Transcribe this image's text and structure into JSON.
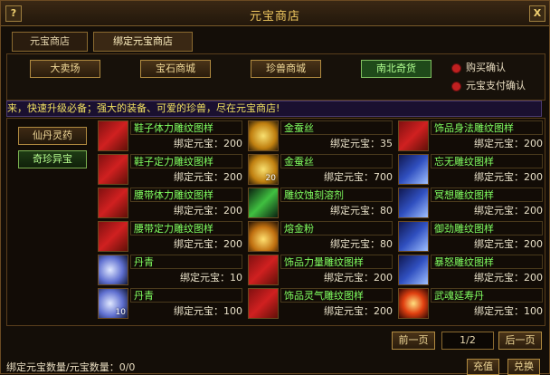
{
  "window": {
    "title": "元宝商店",
    "help_glyph": "?",
    "close_glyph": "X"
  },
  "tabs": [
    {
      "label": "元宝商店",
      "active": false
    },
    {
      "label": "绑定元宝商店",
      "active": true
    }
  ],
  "categories": [
    {
      "label": "大卖场",
      "active": false
    },
    {
      "label": "宝石商城",
      "active": false
    },
    {
      "label": "珍兽商城",
      "active": false
    },
    {
      "label": "南北奇货",
      "active": true
    }
  ],
  "options": [
    {
      "label": "购买确认",
      "checked": true
    },
    {
      "label": "元宝支付确认",
      "checked": true
    }
  ],
  "ticker": "来，快速升级必备；强大的装备、可爱的珍兽，尽在元宝商店!",
  "side_buttons": [
    {
      "label": "仙丹灵药",
      "active": false
    },
    {
      "label": "奇珍异宝",
      "active": true
    }
  ],
  "items": [
    {
      "name": "鞋子体力雕纹图样",
      "price": "绑定元宝：200",
      "icon": "red-scroll-icon",
      "qty": ""
    },
    {
      "name": "金蚕丝",
      "price": "绑定元宝：35",
      "icon": "golden-silk-icon",
      "qty": ""
    },
    {
      "name": "饰品身法雕纹图样",
      "price": "绑定元宝：200",
      "icon": "red-scroll-icon",
      "qty": ""
    },
    {
      "name": "鞋子定力雕纹图样",
      "price": "绑定元宝：200",
      "icon": "red-scroll-icon",
      "qty": ""
    },
    {
      "name": "金蚕丝",
      "price": "绑定元宝：700",
      "icon": "golden-silk-icon",
      "qty": "20"
    },
    {
      "name": "忘无雕纹图样",
      "price": "绑定元宝：200",
      "icon": "blue-scroll-icon",
      "qty": ""
    },
    {
      "name": "腰带体力雕纹图样",
      "price": "绑定元宝：200",
      "icon": "red-scroll-icon",
      "qty": ""
    },
    {
      "name": "雕纹蚀刻溶剂",
      "price": "绑定元宝：80",
      "icon": "green-blade-icon",
      "qty": ""
    },
    {
      "name": "冥想雕纹图样",
      "price": "绑定元宝：200",
      "icon": "blue-scroll-icon",
      "qty": ""
    },
    {
      "name": "腰带定力雕纹图样",
      "price": "绑定元宝：200",
      "icon": "red-scroll-icon",
      "qty": ""
    },
    {
      "name": "熔金粉",
      "price": "绑定元宝：80",
      "icon": "gold-powder-icon",
      "qty": ""
    },
    {
      "name": "御劲雕纹图样",
      "price": "绑定元宝：200",
      "icon": "blue-scroll-icon",
      "qty": ""
    },
    {
      "name": "丹青",
      "price": "绑定元宝：10",
      "icon": "blue-cloud-icon",
      "qty": ""
    },
    {
      "name": "饰品力量雕纹图样",
      "price": "绑定元宝：200",
      "icon": "red-scroll-icon",
      "qty": ""
    },
    {
      "name": "暴怒雕纹图样",
      "price": "绑定元宝：200",
      "icon": "blue-scroll-icon",
      "qty": ""
    },
    {
      "name": "丹青",
      "price": "绑定元宝：100",
      "icon": "blue-cloud-icon",
      "qty": "10"
    },
    {
      "name": "饰品灵气雕纹图样",
      "price": "绑定元宝：200",
      "icon": "red-scroll-icon",
      "qty": ""
    },
    {
      "name": "武魂延寿丹",
      "price": "绑定元宝：100",
      "icon": "fire-orb-icon",
      "qty": ""
    }
  ],
  "pager": {
    "prev": "前一页",
    "page": "1/2",
    "next": "后一页"
  },
  "footer": {
    "status": "绑定元宝数量/元宝数量：0/0",
    "recharge": "充值",
    "exchange": "兑换"
  },
  "colors": {
    "item_name": "#80ff60",
    "accent_gold": "#f0c860",
    "active_category": "#1f4a1a"
  }
}
